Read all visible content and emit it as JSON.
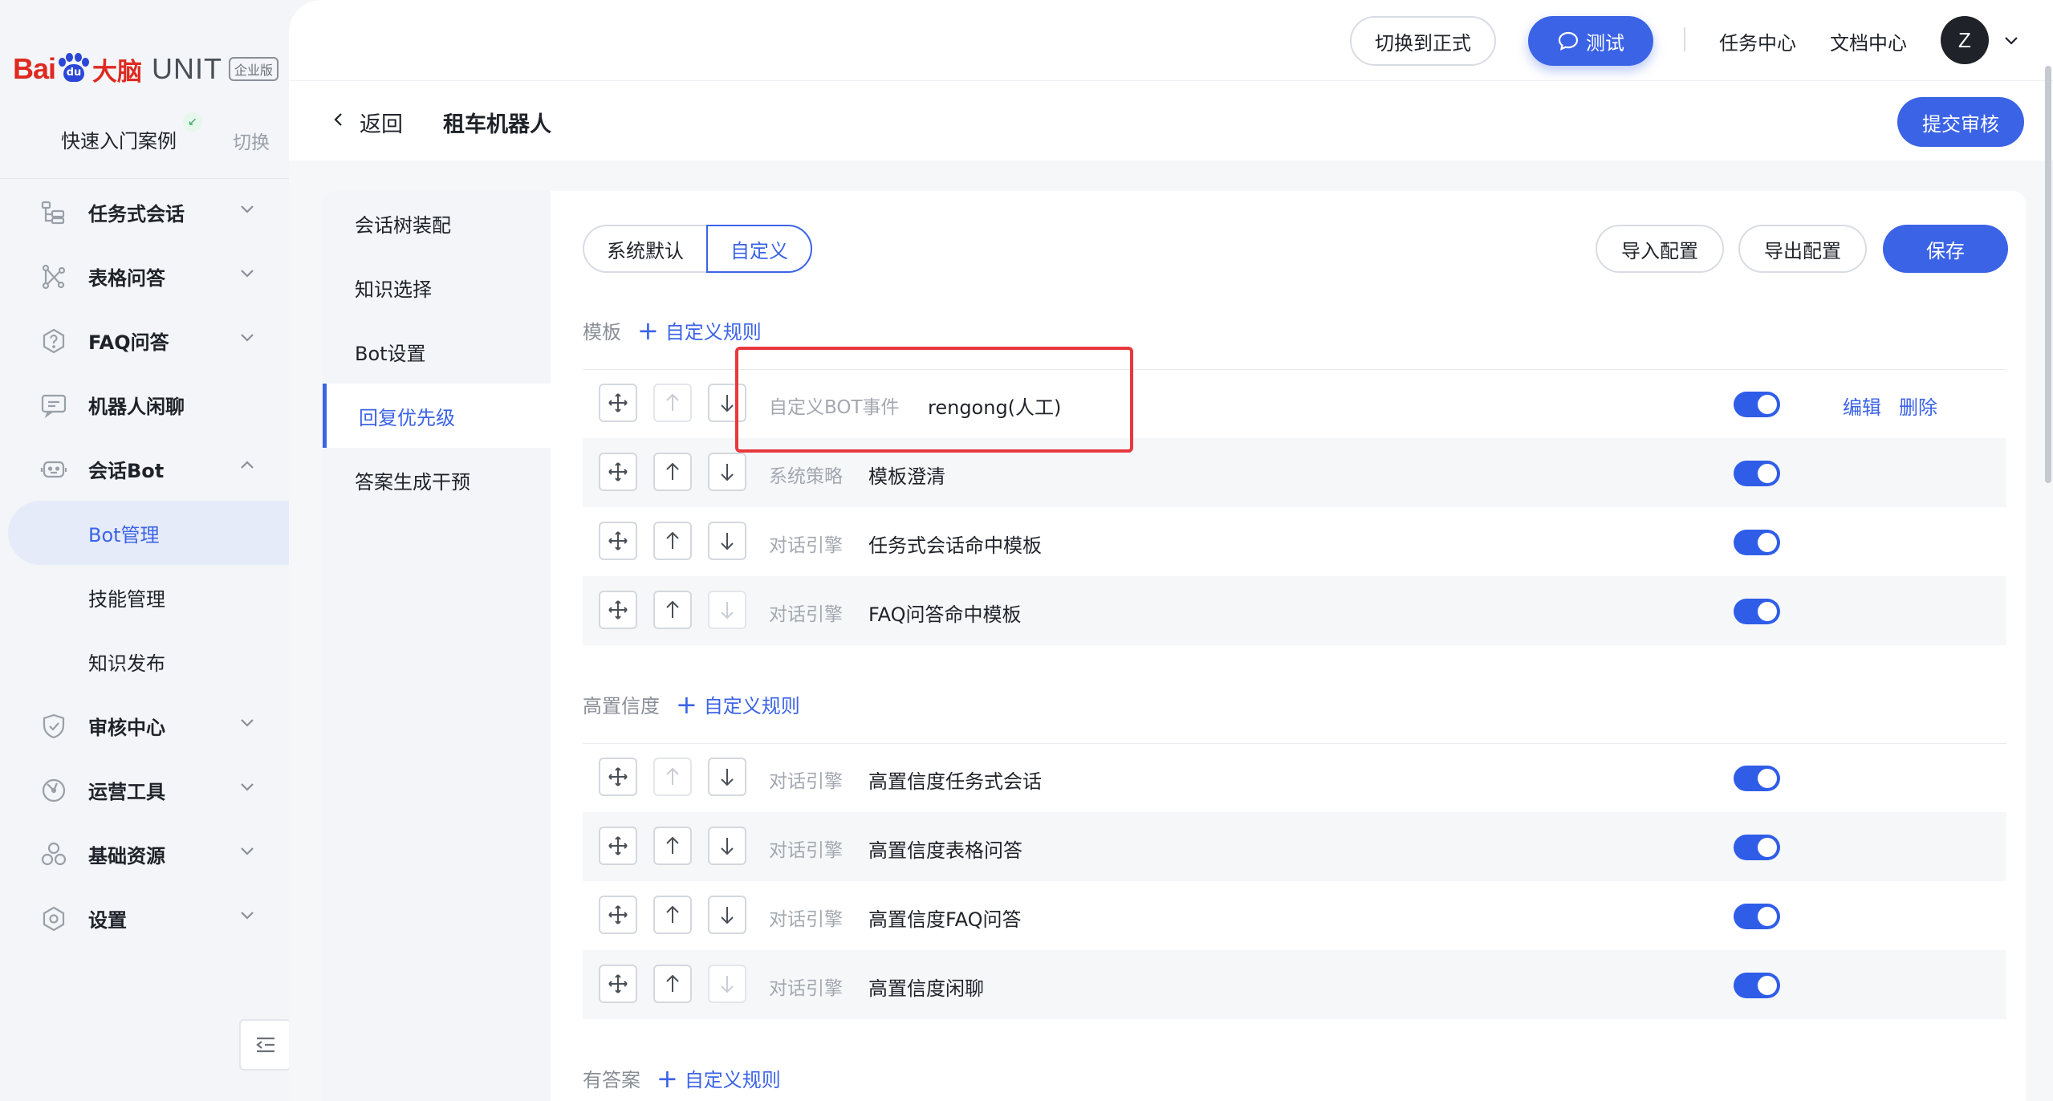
{
  "brand": {
    "bai": "Bai",
    "du": "du",
    "danao": "大脑",
    "unit": "UNIT",
    "edition": "企业版"
  },
  "workspace": {
    "name": "快速入门案例",
    "switch_label": "切换",
    "badge": "↙"
  },
  "sidebar": {
    "items": [
      {
        "label": "任务式会话",
        "icon": "task-dialog-icon",
        "expanded": false
      },
      {
        "label": "表格问答",
        "icon": "table-qa-icon",
        "expanded": false
      },
      {
        "label": "FAQ问答",
        "icon": "faq-icon",
        "expanded": false
      },
      {
        "label": "机器人闲聊",
        "icon": "chitchat-icon",
        "expanded": null
      },
      {
        "label": "会话Bot",
        "icon": "bot-icon",
        "expanded": true
      },
      {
        "label": "Bot管理",
        "sub": true,
        "active": true
      },
      {
        "label": "技能管理",
        "sub": true
      },
      {
        "label": "知识发布",
        "sub": true
      },
      {
        "label": "审核中心",
        "icon": "shield-icon",
        "expanded": false
      },
      {
        "label": "运营工具",
        "icon": "ops-tool-icon",
        "expanded": false
      },
      {
        "label": "基础资源",
        "icon": "resource-icon",
        "expanded": false
      },
      {
        "label": "设置",
        "icon": "settings-icon",
        "expanded": false
      }
    ]
  },
  "topbar": {
    "switch_prod": "切换到正式",
    "test": "测试",
    "task_center": "任务中心",
    "doc_center": "文档中心",
    "avatar": "Z"
  },
  "header": {
    "back": "返回",
    "title": "租车机器人",
    "submit": "提交审核"
  },
  "subnav": {
    "items": [
      "会话树装配",
      "知识选择",
      "Bot设置",
      "回复优先级",
      "答案生成干预"
    ],
    "active_index": 3
  },
  "segment": {
    "options": [
      "系统默认",
      "自定义"
    ],
    "active_index": 1
  },
  "actions": {
    "import": "导入配置",
    "export": "导出配置",
    "save": "保存"
  },
  "sections": [
    {
      "label": "模板",
      "add_label": "自定义规则",
      "rules": [
        {
          "type": "自定义BOT事件",
          "name": "rengong(人工)",
          "up_disabled": true,
          "down_disabled": false,
          "enabled": true,
          "edit": "编辑",
          "delete": "删除"
        },
        {
          "type": "系统策略",
          "name": "模板澄清",
          "up_disabled": false,
          "down_disabled": false,
          "enabled": true
        },
        {
          "type": "对话引擎",
          "name": "任务式会话命中模板",
          "up_disabled": false,
          "down_disabled": false,
          "enabled": true
        },
        {
          "type": "对话引擎",
          "name": "FAQ问答命中模板",
          "up_disabled": false,
          "down_disabled": true,
          "enabled": true
        }
      ]
    },
    {
      "label": "高置信度",
      "add_label": "自定义规则",
      "rules": [
        {
          "type": "对话引擎",
          "name": "高置信度任务式会话",
          "up_disabled": true,
          "down_disabled": false,
          "enabled": true
        },
        {
          "type": "对话引擎",
          "name": "高置信度表格问答",
          "up_disabled": false,
          "down_disabled": false,
          "enabled": true
        },
        {
          "type": "对话引擎",
          "name": "高置信度FAQ问答",
          "up_disabled": false,
          "down_disabled": false,
          "enabled": true
        },
        {
          "type": "对话引擎",
          "name": "高置信度闲聊",
          "up_disabled": false,
          "down_disabled": true,
          "enabled": true
        }
      ]
    },
    {
      "label": "有答案",
      "add_label": "自定义规则",
      "rules": []
    }
  ],
  "colors": {
    "accent": "#3b63e6",
    "toggle_on": "#2f5de8",
    "highlight": "#e8383d",
    "brand_red": "#de2a21"
  }
}
